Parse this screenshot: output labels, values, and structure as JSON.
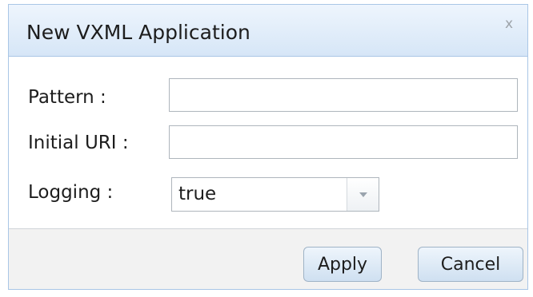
{
  "dialog": {
    "title": "New VXML Application",
    "close_glyph": "x"
  },
  "fields": {
    "pattern": {
      "label": "Pattern :",
      "value": ""
    },
    "initial_uri": {
      "label": "Initial URI :",
      "value": ""
    },
    "logging": {
      "label": "Logging :",
      "value": "true",
      "arrow_icon": "chevron-down-icon"
    }
  },
  "footer": {
    "apply_label": "Apply",
    "cancel_label": "Cancel"
  }
}
